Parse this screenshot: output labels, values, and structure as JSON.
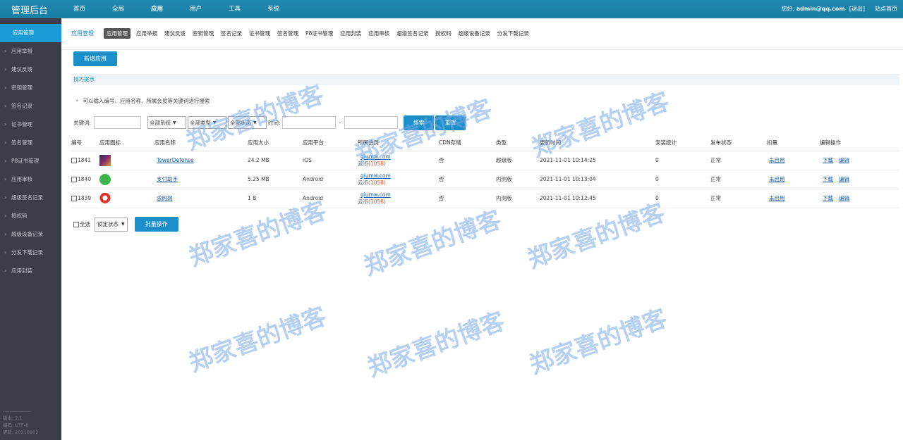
{
  "topbar": {
    "brand": "管理后台",
    "nav": [
      "首页",
      "全局",
      "应用",
      "用户",
      "工具",
      "系统"
    ],
    "greeting": "您好,",
    "user": "admin@qq.com",
    "logout": "[退出]",
    "home": "站点首页"
  },
  "sidebar": {
    "items": [
      "应用管理",
      "应用举报",
      "建议反馈",
      "密钥管理",
      "签名记录",
      "证书管理",
      "签名管理",
      "P8证书管理",
      "应用审核",
      "超级签名记录",
      "授权码",
      "超级设备记录",
      "分发下载记录",
      "应用封装"
    ],
    "foot": {
      "line": "-----------------",
      "version": "版本: 2.1",
      "encoding": "编码: UTF-8",
      "updated": "更新: 20210902"
    }
  },
  "subtabs": {
    "title": "应用管理",
    "tabs": [
      "应用管理",
      "应用举报",
      "建议反馈",
      "密钥管理",
      "签名记录",
      "证书管理",
      "签名管理",
      "P8证书管理",
      "应用封装",
      "应用审核",
      "超级签名记录",
      "授权码",
      "超级设备记录",
      "分发下载记录"
    ]
  },
  "new_app": "新增应用",
  "tips": {
    "title": "技巧提示",
    "text": "可以输入编号、应用名称、所属会员等关键词进行搜索"
  },
  "search": {
    "keyword_label": "关键词:",
    "system": "全部系统",
    "type": "全部类型",
    "status": "全部状态",
    "time_label": "时间:",
    "dash": "-",
    "search_btn": "搜索",
    "reset_btn": "重置"
  },
  "table": {
    "headers": [
      "编号",
      "应用图标",
      "应用名称",
      "应用大小",
      "应用平台",
      "所属会员",
      "CDN存储",
      "类型",
      "更新时间",
      "安装统计",
      "发布状态",
      "扣量",
      "编辑操作"
    ],
    "rows": [
      {
        "id": "1841",
        "name": "TowerDefense",
        "size": "24.2 MB",
        "platform": "iOS",
        "member": "qiumw.com",
        "coins_label": "云币",
        "coins": "(1058)",
        "cdn": "否",
        "type": "超级版",
        "time": "2021-11-01 10:14:25",
        "installs": "0",
        "status": "正常",
        "deduct": "未启用",
        "download": "下载",
        "edit": "编辑",
        "icon_color": "#4a3a7a"
      },
      {
        "id": "1840",
        "name": "支付助手",
        "size": "5.25 MB",
        "platform": "Android",
        "member": "qiumw.com",
        "coins_label": "云币",
        "coins": "(1058)",
        "cdn": "否",
        "type": "内测版",
        "time": "2021-11-01 10:13:04",
        "installs": "0",
        "status": "正常",
        "deduct": "未启用",
        "download": "下载",
        "edit": "编辑",
        "icon_color": "#3cb54a"
      },
      {
        "id": "1839",
        "name": "求码网",
        "size": "1 B",
        "platform": "Android",
        "member": "qiumw.com",
        "coins_label": "云币",
        "coins": "(1058)",
        "cdn": "否",
        "type": "内测版",
        "time": "2021-11-01 10:12:45",
        "installs": "0",
        "status": "正常",
        "deduct": "未启用",
        "download": "下载",
        "edit": "编辑",
        "icon_color": "#d9342b"
      }
    ]
  },
  "bottom": {
    "select_all": "全选",
    "lock_status": "锁定状态",
    "batch": "批量操作"
  },
  "watermark": "郑家喜的博客"
}
